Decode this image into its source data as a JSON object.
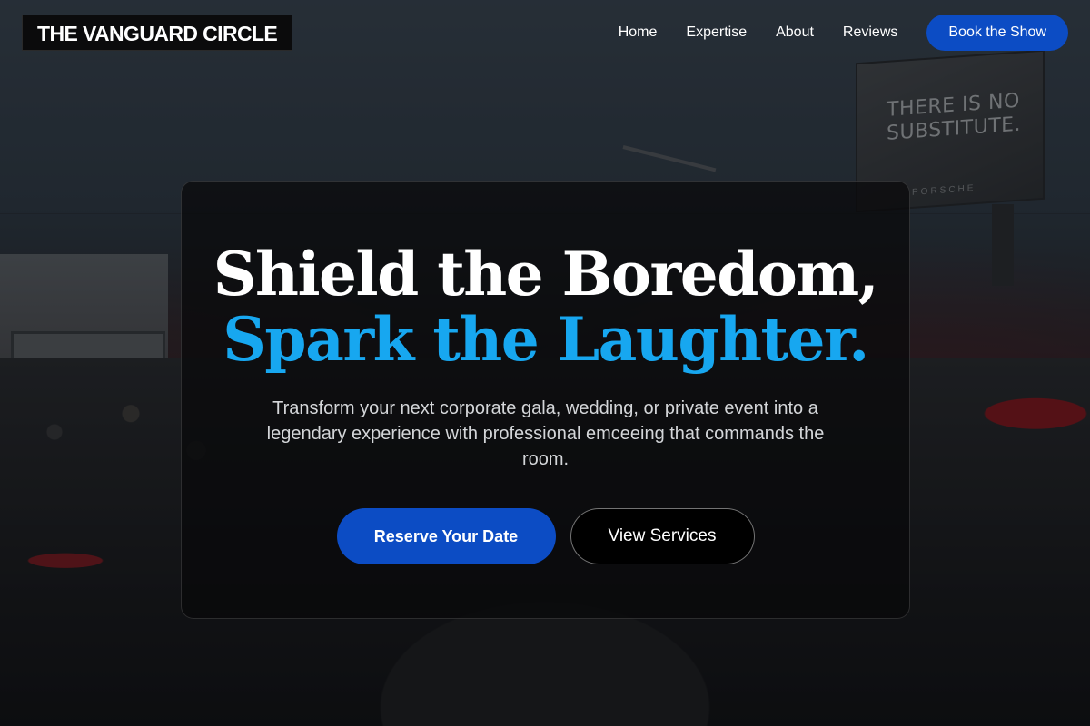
{
  "header": {
    "logo": "THE VANGUARD CIRCLE",
    "nav": [
      {
        "label": "Home"
      },
      {
        "label": "Expertise"
      },
      {
        "label": "About"
      },
      {
        "label": "Reviews"
      }
    ],
    "cta_label": "Book the Show"
  },
  "hero": {
    "title_line1": "Shield the Boredom,",
    "title_line2": "Spark the Laughter.",
    "subtitle": "Transform your next corporate gala, wedding, or private event into a legendary experience with professional emceeing that commands the room.",
    "primary_button": "Reserve Your Date",
    "secondary_button": "View Services"
  },
  "background": {
    "billboard_text": "THERE IS NO SUBSTITUTE.",
    "billboard_brand": "PORSCHE"
  },
  "colors": {
    "accent": "#17a7f0",
    "button_blue": "#0c4cc4",
    "card_bg": "#08080a"
  }
}
